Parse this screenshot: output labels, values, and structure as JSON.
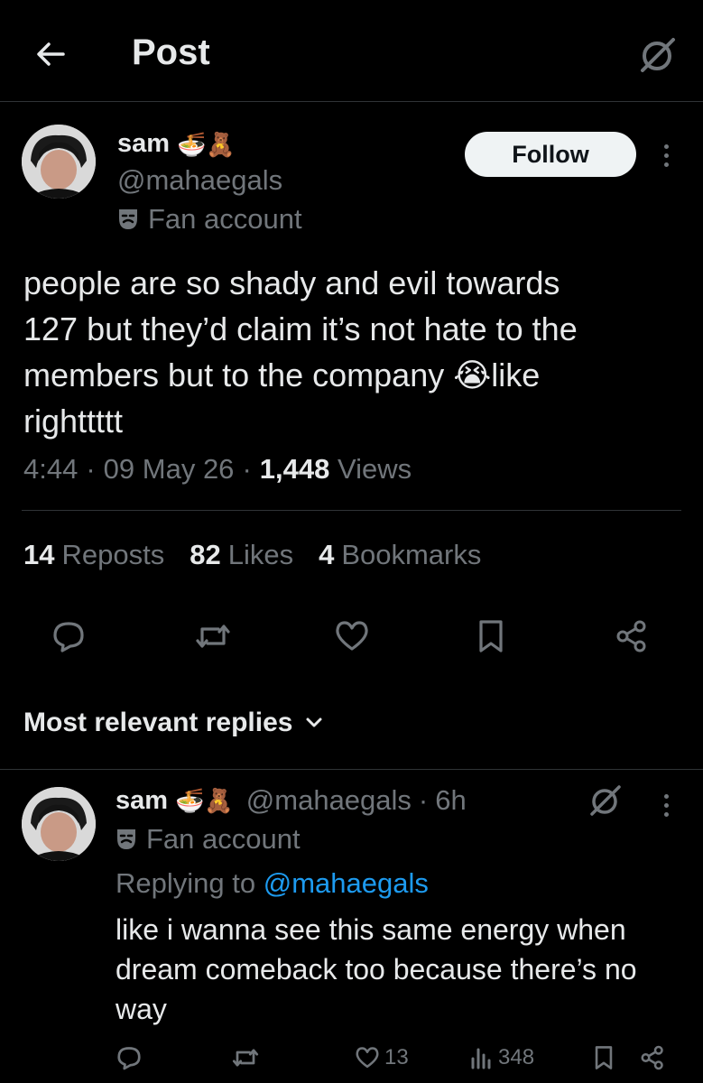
{
  "header": {
    "title": "Post",
    "back_icon": "arrow-left-icon",
    "grok_icon": "grok-icon"
  },
  "post": {
    "author": {
      "name": "sam",
      "name_emojis": "🍜🧸",
      "handle": "@mahaegals",
      "label_icon": "theater-mask-icon",
      "label": "Fan account"
    },
    "follow_label": "Follow",
    "text_lines": [
      "people are so shady and evil towards",
      "127 but they’d claim it’s not hate to the",
      "members but to the company 😭like",
      "righttttt"
    ],
    "time": "4:44",
    "date": "09 May 26",
    "views_count": "1,448",
    "views_label": "Views",
    "stats": {
      "reposts_count": "14",
      "reposts_label": "Reposts",
      "likes_count": "82",
      "likes_label": "Likes",
      "bookmarks_count": "4",
      "bookmarks_label": "Bookmarks"
    },
    "actions": [
      "reply-icon",
      "repost-icon",
      "like-icon",
      "bookmark-icon",
      "share-icon"
    ]
  },
  "replies_section": {
    "label": "Most relevant replies"
  },
  "reply": {
    "author": {
      "name": "sam",
      "name_emojis": "🍜🧸",
      "handle": "@mahaegals",
      "time": "6h",
      "label": "Fan account"
    },
    "replying_prefix": "Replying to",
    "replying_to": "@mahaegals",
    "text_lines": [
      "like i wanna see this same energy when",
      "dream comeback too because there’s no",
      "way"
    ],
    "likes": "13",
    "views": "348"
  },
  "colors": {
    "background": "#000000",
    "text": "#e7e9ea",
    "muted": "#71767b",
    "link": "#1d9bf0",
    "divider": "#2f3336"
  }
}
